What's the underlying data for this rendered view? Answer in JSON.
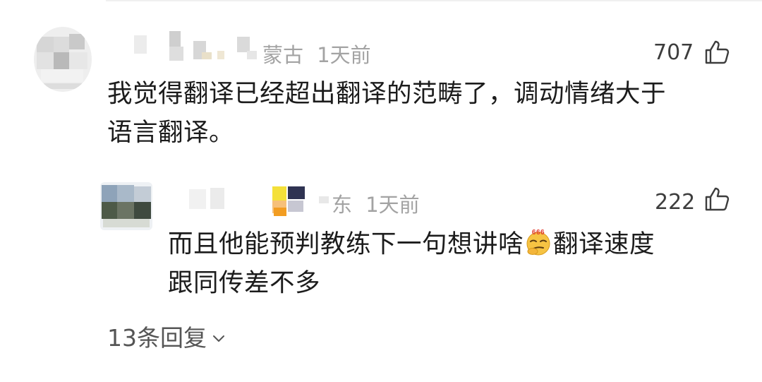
{
  "comments": [
    {
      "location": "蒙古",
      "time": "1天前",
      "likes": "707",
      "text_line1": "我觉得翻译已经超出翻译的范畴了，调动情绪大于",
      "text_line2": "语言翻译。"
    }
  ],
  "reply": {
    "location": "东",
    "time": "1天前",
    "likes": "222",
    "text_line1_before_emoji": "而且他能预判教练下一句想讲啥",
    "emoji_name": "666-smug-emoji",
    "emoji_label": "666",
    "text_line1_after_emoji": "翻译速度",
    "text_line2": "跟同传差不多"
  },
  "replies_link": {
    "label": "13条回复",
    "icon": "chevron-down-icon"
  },
  "colors": {
    "meta_gray": "#a3a3a3",
    "text": "#1c1c1c",
    "emoji_yellow": "#f6c343",
    "emoji_red": "#e23a2e"
  }
}
